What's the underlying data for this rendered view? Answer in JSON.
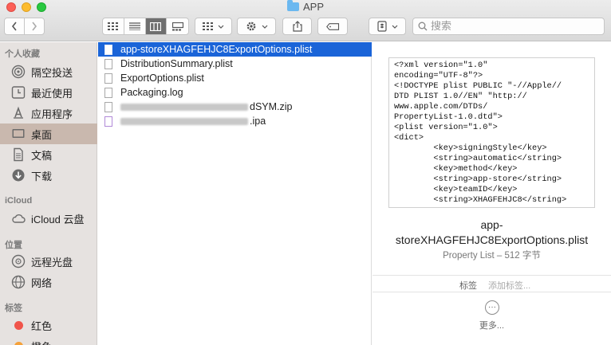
{
  "window": {
    "title": "APP"
  },
  "toolbar": {
    "back_label": "<",
    "forward_label": ">",
    "search": {
      "placeholder": "搜索"
    }
  },
  "sidebar": {
    "sections": [
      {
        "heading": "个人收藏",
        "items": [
          {
            "label": "隔空投送",
            "icon": "airdrop-icon"
          },
          {
            "label": "最近使用",
            "icon": "clock-icon"
          },
          {
            "label": "应用程序",
            "icon": "applications-icon"
          },
          {
            "label": "桌面",
            "icon": "desktop-icon",
            "selected": true
          },
          {
            "label": "文稿",
            "icon": "documents-icon"
          },
          {
            "label": "下载",
            "icon": "download-icon"
          }
        ]
      },
      {
        "heading": "iCloud",
        "items": [
          {
            "label": "iCloud 云盘",
            "icon": "cloud-icon"
          }
        ]
      },
      {
        "heading": "位置",
        "items": [
          {
            "label": "远程光盘",
            "icon": "disc-icon"
          },
          {
            "label": "网络",
            "icon": "network-icon"
          }
        ]
      },
      {
        "heading": "标签",
        "items": [
          {
            "label": "红色",
            "icon": "tag-dot-icon",
            "color": "#f0544a"
          },
          {
            "label": "橙色",
            "icon": "tag-dot-icon",
            "color": "#f5a13a"
          }
        ]
      }
    ]
  },
  "files": [
    {
      "name": "app-storeXHAGFEHJC8ExportOptions.plist",
      "selected": true
    },
    {
      "name": "DistributionSummary.plist"
    },
    {
      "name": "ExportOptions.plist"
    },
    {
      "name": "Packaging.log"
    },
    {
      "name_suffix": "dSYM.zip",
      "obscured": true
    },
    {
      "name_suffix": ".ipa",
      "obscured": true
    }
  ],
  "preview": {
    "content": "<?xml version=\"1.0\"\nencoding=\"UTF-8\"?>\n<!DOCTYPE plist PUBLIC \"-//Apple//\nDTD PLIST 1.0//EN\" \"http://\nwww.apple.com/DTDs/\nPropertyList-1.0.dtd\">\n<plist version=\"1.0\">\n<dict>\n        <key>signingStyle</key>\n        <string>automatic</string>\n        <key>method</key>\n        <string>app-store</string>\n        <key>teamID</key>\n        <string>XHAGFEHJC8</string>",
    "name_line1": "app-",
    "name_line2": "storeXHAGFEHJC8ExportOptions.plist",
    "kind_size": "Property List – 512 字节",
    "tags_label": "标签",
    "tags_placeholder": "添加标签...",
    "more_label": "更多..."
  },
  "colors": {
    "selection": "#1a64d8",
    "sidebar_bg": "#e6e2e0",
    "sidebar_selected": "#c9b8ae"
  }
}
